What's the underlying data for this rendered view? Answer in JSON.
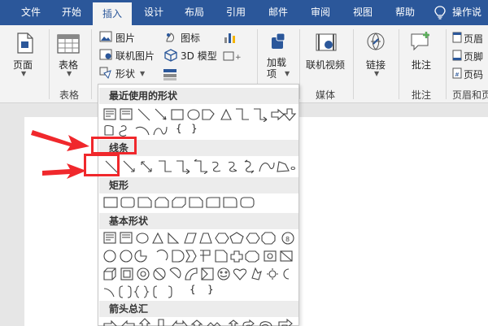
{
  "tabs": [
    "文件",
    "开始",
    "插入",
    "设计",
    "布局",
    "引用",
    "邮件",
    "审阅",
    "视图",
    "帮助",
    "操作说明"
  ],
  "active_tab": "插入",
  "ribbon": {
    "page_label": "页面",
    "table_label": "表格",
    "table_group": "表格",
    "picture": "图片",
    "online_picture": "联机图片",
    "shapes": "形状",
    "icons": "图标",
    "model3d": "3D 模型",
    "addins": "加载\n项",
    "online_video": "联机视频",
    "media_group": "媒体",
    "link": "链接",
    "comment": "批注",
    "comment_group": "批注",
    "header_footer_group": "页眉和页",
    "header": "页眉",
    "footer": "页脚",
    "page_number": "页码"
  },
  "dropdown": {
    "sections": [
      "最近使用的形状",
      "线条",
      "矩形",
      "基本形状",
      "箭头总汇"
    ],
    "recent_text_chars": [
      "{",
      "}"
    ],
    "basic_text_chars": [
      "{",
      "}"
    ]
  },
  "colors": {
    "brand": "#2b579a",
    "callout": "#f0282c"
  },
  "icons": [
    "lightbulb-icon",
    "page-icon",
    "table-icon",
    "picture-icon",
    "shapes-icon",
    "icons-icon",
    "3d-model-icon",
    "chart-icon",
    "addins-icon",
    "video-icon",
    "link-icon",
    "comment-icon",
    "header-icon"
  ]
}
